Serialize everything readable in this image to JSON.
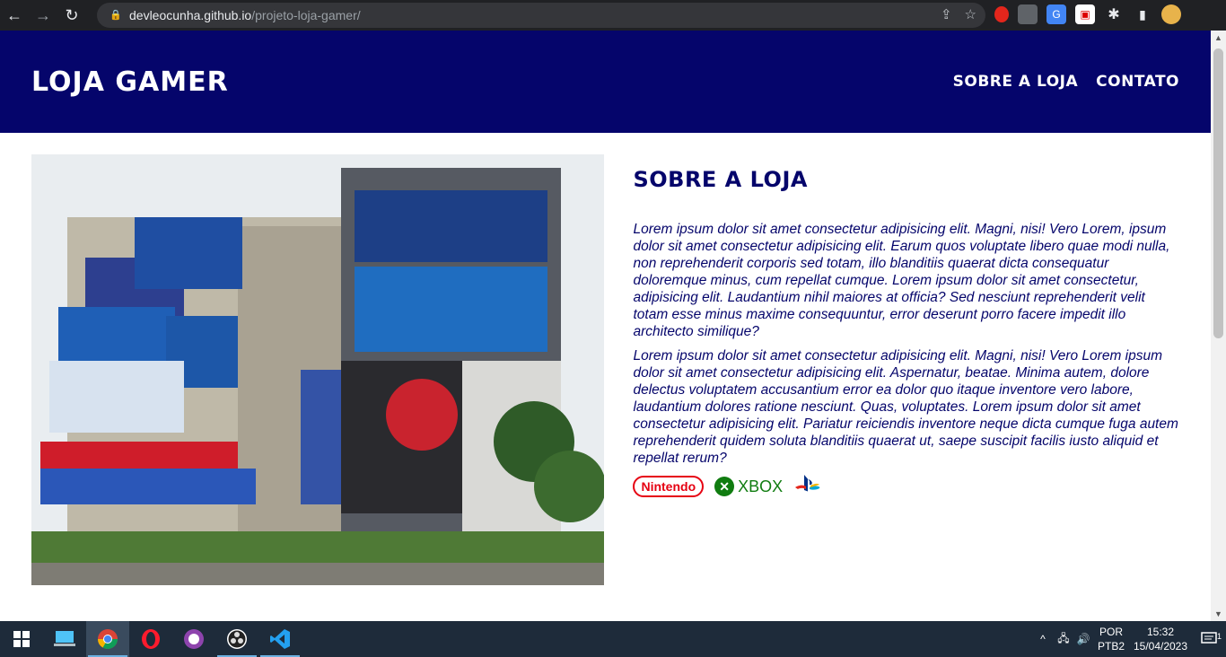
{
  "browser": {
    "url_host": "devleocunha.github.io",
    "url_path": "/projeto-loja-gamer/"
  },
  "site": {
    "logo": "LOJA GAMER",
    "menu": [
      {
        "label": "SOBRE A LOJA"
      },
      {
        "label": "CONTATO"
      }
    ]
  },
  "about": {
    "title": "SOBRE A LOJA",
    "paragraphs": [
      "Lorem ipsum dolor sit amet consectetur adipisicing elit. Magni, nisi! Vero Lorem, ipsum dolor sit amet consectetur adipisicing elit. Earum quos voluptate libero quae modi nulla, non reprehenderit corporis sed totam, illo blanditiis quaerat dicta consequatur doloremque minus, cum repellat cumque. Lorem ipsum dolor sit amet consectetur, adipisicing elit. Laudantium nihil maiores at officia? Sed nesciunt reprehenderit velit totam esse minus maxime consequuntur, error deserunt porro facere impedit illo architecto similique?",
      "Lorem ipsum dolor sit amet consectetur adipisicing elit. Magni, nisi! Vero Lorem ipsum dolor sit amet consectetur adipisicing elit. Aspernatur, beatae. Minima autem, dolore delectus voluptatem accusantium error ea dolor quo itaque inventore vero labore, laudantium dolores ratione nesciunt. Quas, voluptates. Lorem ipsum dolor sit amet consectetur adipisicing elit. Pariatur reiciendis inventore neque dicta cumque fuga autem reprehenderit quidem soluta blanditiis quaerat ut, saepe suscipit facilis iusto aliquid et repellat rerum?"
    ],
    "brands": {
      "nintendo": "Nintendo",
      "xbox": "XBOX"
    }
  },
  "taskbar": {
    "lang_top": "POR",
    "lang_bottom": "PTB2",
    "time": "15:32",
    "date": "15/04/2023",
    "notification_count": "1"
  },
  "colors": {
    "header_bg": "#05056b",
    "text": "#05056b"
  }
}
